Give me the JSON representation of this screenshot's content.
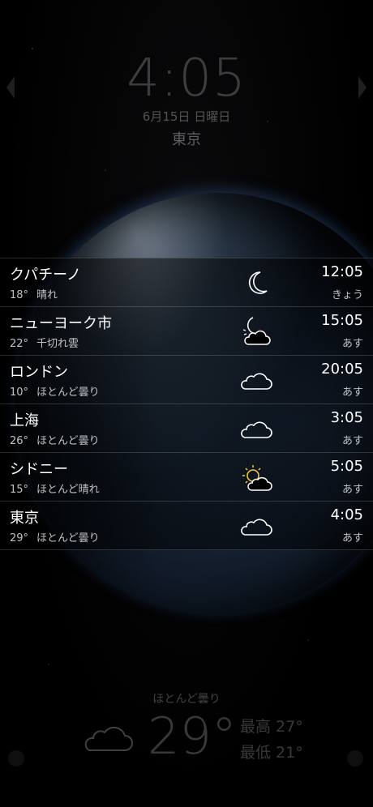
{
  "header": {
    "time": "4:05",
    "date": "6月15日 日曜日",
    "city": "東京"
  },
  "cities": [
    {
      "name": "クパチーノ",
      "temp": "18°",
      "condition": "晴れ",
      "time": "12:05",
      "day": "きょう",
      "icon": "moon-icon"
    },
    {
      "name": "ニューヨーク市",
      "temp": "22°",
      "condition": "千切れ雲",
      "time": "15:05",
      "day": "あす",
      "icon": "moon-cloud-icon"
    },
    {
      "name": "ロンドン",
      "temp": "10°",
      "condition": "ほとんど曇り",
      "time": "20:05",
      "day": "あす",
      "icon": "cloud-icon"
    },
    {
      "name": "上海",
      "temp": "26°",
      "condition": "ほとんど曇り",
      "time": "3:05",
      "day": "あす",
      "icon": "cloud-icon"
    },
    {
      "name": "シドニー",
      "temp": "15°",
      "condition": "ほとんど晴れ",
      "time": "5:05",
      "day": "あす",
      "icon": "sun-cloud-icon"
    },
    {
      "name": "東京",
      "temp": "29°",
      "condition": "ほとんど曇り",
      "time": "4:05",
      "day": "あす",
      "icon": "cloud-icon"
    }
  ],
  "current": {
    "condition": "ほとんど曇り",
    "temp": "29°",
    "high": "最高 27°",
    "low": "最低 21°",
    "icon": "cloud-icon"
  },
  "colors": {
    "sun": "#f2c94c",
    "icon_stroke": "#ffffff"
  }
}
